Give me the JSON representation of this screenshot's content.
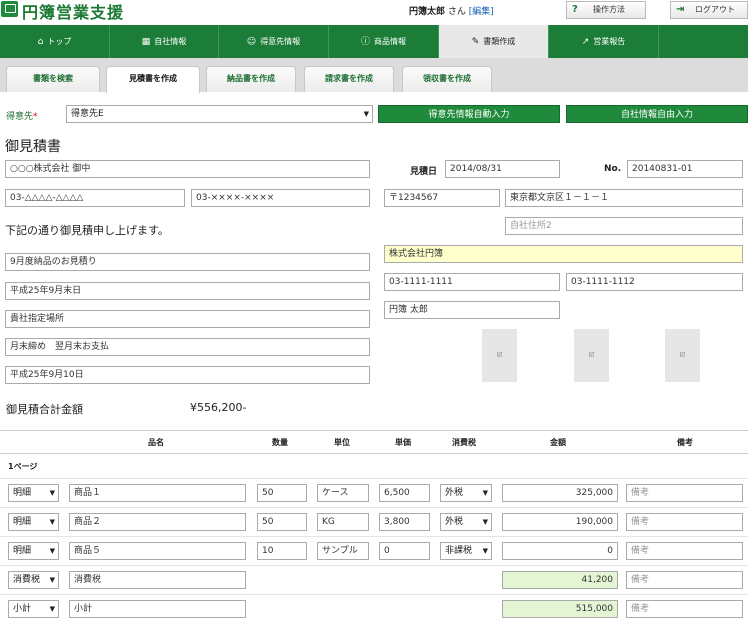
{
  "header": {
    "app_title": "円簿営業支援",
    "logo_small": "円簿",
    "user_name": "円簿太郎",
    "honorific": " さん ",
    "edit_link": "[編集]",
    "help_icon": "?",
    "help_label": "操作方法",
    "logout_label": "ログアウト"
  },
  "nav": {
    "items": [
      {
        "label": "トップ",
        "icon": "home-icon"
      },
      {
        "label": "自社情報",
        "icon": "building-icon"
      },
      {
        "label": "得意先情報",
        "icon": "users-icon"
      },
      {
        "label": "商品情報",
        "icon": "info-icon"
      },
      {
        "label": "書類作成",
        "icon": "edit-icon"
      },
      {
        "label": "営業報告",
        "icon": "chart-icon"
      }
    ],
    "active_index": 4
  },
  "subtabs": {
    "items": [
      "書類を検索",
      "見積書を作成",
      "納品書を作成",
      "請求書を作成",
      "領収書を作成"
    ],
    "active_index": 1
  },
  "customer_row": {
    "label": "得意先",
    "required_mark": "*",
    "selected": "得意先E",
    "auto_fill_button": "得意先情報自動入力",
    "free_input_button": "自社情報自由入力"
  },
  "document": {
    "title": "御見積書",
    "recipient": "○○○株式会社 御中",
    "recipient_tel": "03-△△△△-△△△△",
    "recipient_fax": "03-××××-××××",
    "estimate_date_label": "見積日",
    "estimate_date": "2014/08/31",
    "number_label": "No.",
    "number": "20140831-01",
    "zip": "〒1234567",
    "address1": "東京都文京区１－１－１",
    "address2_placeholder": "自社住所2",
    "greeting": "下記の通り御見積申し上げます。",
    "subject": "9月度納品のお見積り",
    "delivery_date": "平成25年9月末日",
    "delivery_place": "貴社指定場所",
    "payment_terms": "月末締め　翌月末お支払",
    "valid_until": "平成25年9月10日",
    "company_name": "株式会社円簿",
    "company_tel": "03-1111-1111",
    "company_fax": "03-1111-1112",
    "person": "円簿 太郎",
    "stamp_label": "印",
    "total_label": "御見積合計金額",
    "total_value": "¥556,200-"
  },
  "table": {
    "headers": [
      "品名",
      "数量",
      "単位",
      "単価",
      "消費税",
      "金額",
      "備考"
    ],
    "page_label": "1ページ",
    "note_placeholder": "備考",
    "rows": [
      {
        "type": "明細",
        "name": "商品１",
        "qty": "50",
        "unit": "ケース",
        "price": "6,500",
        "tax": "外税",
        "amount": "325,000"
      },
      {
        "type": "明細",
        "name": "商品２",
        "qty": "50",
        "unit": "KG",
        "price": "3,800",
        "tax": "外税",
        "amount": "190,000"
      },
      {
        "type": "明細",
        "name": "商品５",
        "qty": "10",
        "unit": "サンプル",
        "price": "0",
        "tax": "非課税",
        "amount": "0"
      }
    ],
    "tax_row": {
      "type": "消費税",
      "name": "消費税",
      "amount": "41,200"
    },
    "subtotal_row": {
      "type": "小計",
      "name": "小計",
      "amount": "515,000"
    }
  },
  "colors": {
    "brand_green": "#1b7d37",
    "highlight_yellow": "#ffffcc",
    "highlight_green": "#e4f5d4"
  }
}
